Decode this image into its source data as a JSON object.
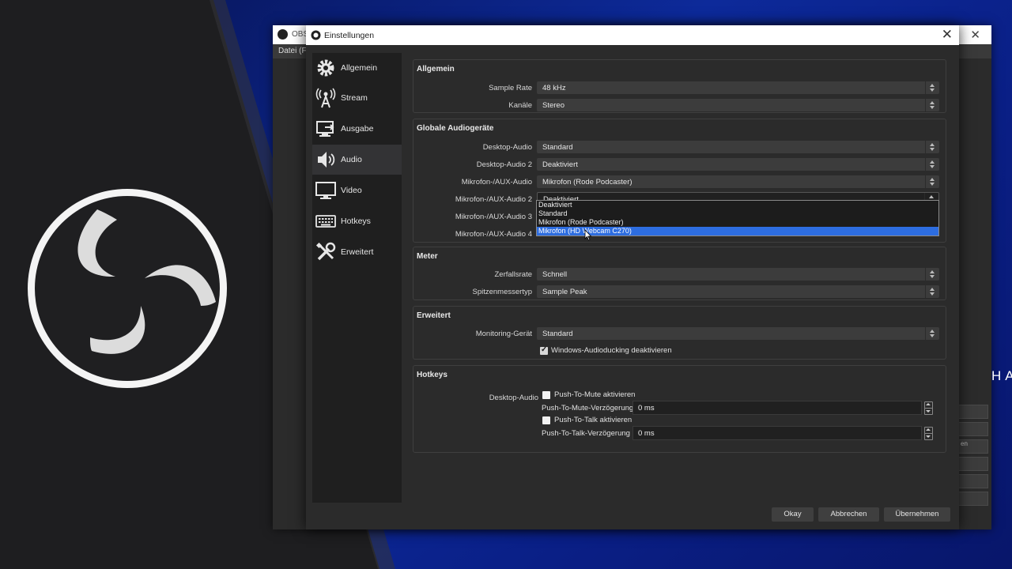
{
  "main_window": {
    "title": "OBS",
    "menu": "Datei (F",
    "brand_partial": "HAV",
    "panel_rows": [
      "",
      "",
      "en",
      "",
      "",
      ""
    ]
  },
  "dialog": {
    "title": "Einstellungen",
    "close_glyph": "✕"
  },
  "sidebar": {
    "items": [
      {
        "label": "Allgemein",
        "icon": "gear-icon"
      },
      {
        "label": "Stream",
        "icon": "broadcast-icon"
      },
      {
        "label": "Ausgabe",
        "icon": "output-monitor-icon"
      },
      {
        "label": "Audio",
        "icon": "speaker-icon",
        "active": true
      },
      {
        "label": "Video",
        "icon": "monitor-icon"
      },
      {
        "label": "Hotkeys",
        "icon": "keyboard-icon"
      },
      {
        "label": "Erweitert",
        "icon": "tools-icon"
      }
    ]
  },
  "general": {
    "title": "Allgemein",
    "sample_rate_label": "Sample Rate",
    "sample_rate": "48 kHz",
    "channels_label": "Kanäle",
    "channels": "Stereo"
  },
  "global_audio": {
    "title": "Globale Audiogeräte",
    "desktop_audio_label": "Desktop-Audio",
    "desktop_audio": "Standard",
    "desktop_audio2_label": "Desktop-Audio 2",
    "desktop_audio2": "Deaktiviert",
    "mic_label": "Mikrofon-/AUX-Audio",
    "mic": "Mikrofon (Rode Podcaster)",
    "mic2_label": "Mikrofon-/AUX-Audio 2",
    "mic2": "Deaktiviert",
    "mic3_label": "Mikrofon-/AUX-Audio 3",
    "mic4_label": "Mikrofon-/AUX-Audio 4",
    "dropdown_options": [
      "Deaktiviert",
      "Standard",
      "Mikrofon (Rode Podcaster)",
      "Mikrofon (HD Webcam C270)"
    ]
  },
  "meter": {
    "title": "Meter",
    "decay_label": "Zerfallsrate",
    "decay": "Schnell",
    "peak_label": "Spitzenmessertyp",
    "peak": "Sample Peak"
  },
  "advanced": {
    "title": "Erweitert",
    "monitoring_label": "Monitoring-Gerät",
    "monitoring": "Standard",
    "ducking_label": "Windows-Audioducking deaktivieren",
    "ducking_checked": true
  },
  "hotkeys": {
    "title": "Hotkeys",
    "source_label": "Desktop-Audio",
    "ptm_enable": "Push-To-Mute aktivieren",
    "ptm_delay_label": "Push-To-Mute-Verzögerung",
    "ptm_delay": "0 ms",
    "ptt_enable": "Push-To-Talk aktivieren",
    "ptt_delay_label": "Push-To-Talk-Verzögerung",
    "ptt_delay": "0 ms"
  },
  "buttons": {
    "ok": "Okay",
    "cancel": "Abbrechen",
    "apply": "Übernehmen"
  },
  "colors": {
    "accent": "#2d6de0",
    "dialog_bg": "#2b2b2b",
    "sidebar_bg": "#1f1f1f"
  }
}
